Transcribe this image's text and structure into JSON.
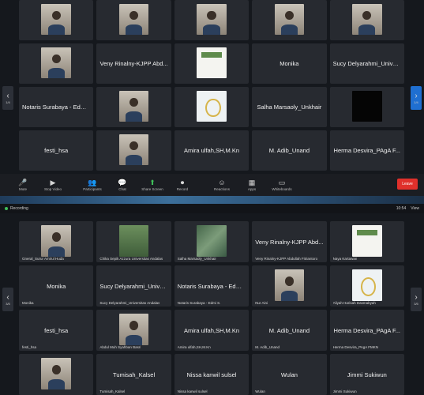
{
  "top": {
    "tiles": [
      {
        "name": "",
        "kind": "person"
      },
      {
        "name": "",
        "kind": "person"
      },
      {
        "name": "",
        "kind": "person"
      },
      {
        "name": "",
        "kind": "person"
      },
      {
        "name": "",
        "kind": "person"
      },
      {
        "name": "",
        "kind": "person"
      },
      {
        "name": "Veny Rinalny-KJPP Abd...",
        "kind": "name"
      },
      {
        "name": "",
        "kind": "slide"
      },
      {
        "name": "Monika",
        "kind": "name"
      },
      {
        "name": "Sucy Delyarahmi_Univer...",
        "kind": "name"
      },
      {
        "name": "Notaris Surabaya - Edmi...",
        "kind": "name"
      },
      {
        "name": "",
        "kind": "person"
      },
      {
        "name": "",
        "kind": "logo"
      },
      {
        "name": "Salha Marsaoly_Unkhair",
        "kind": "name"
      },
      {
        "name": "",
        "kind": "dark"
      },
      {
        "name": "festi_hsa",
        "kind": "name"
      },
      {
        "name": "",
        "kind": "person"
      },
      {
        "name": "Amira ulfah,SH,M.Kn",
        "kind": "name"
      },
      {
        "name": "M. Adib_Unand",
        "kind": "name"
      },
      {
        "name": "Herma Desvira_PAgA F...",
        "kind": "name"
      }
    ],
    "nav": {
      "left_page": "1/4",
      "right_page": "1/4"
    },
    "toolbar": [
      {
        "label": "Mute",
        "icon": "🎤"
      },
      {
        "label": "Stop Video",
        "icon": "▶"
      },
      {
        "label": "Participants",
        "icon": "👥"
      },
      {
        "label": "Chat",
        "icon": "💬"
      },
      {
        "label": "Share Screen",
        "icon": "⬆"
      },
      {
        "label": "Record",
        "icon": "⏺"
      },
      {
        "label": "Reactions",
        "icon": "☺"
      },
      {
        "label": "Apps",
        "icon": "▦"
      },
      {
        "label": "Whiteboards",
        "icon": "▭"
      }
    ],
    "leave_label": "Leave"
  },
  "bottom": {
    "recording_label": "Recording",
    "clock": "10:54",
    "view_label": "View",
    "tiles": [
      {
        "name": "",
        "kind": "person",
        "caption": "Gneral_Surur Amirul Huda"
      },
      {
        "name": "",
        "kind": "green",
        "caption": "Chika Sepik Azzura Universitas Andalas"
      },
      {
        "name": "",
        "kind": "map",
        "caption": "Salha Marsaoly_Unkhair"
      },
      {
        "name": "Veny Rinalny-KJPP Abd...",
        "kind": "name",
        "caption": "Veny Rinalny-KJPP Abdullah Fitriantoro"
      },
      {
        "name": "",
        "kind": "slide",
        "caption": "Naya Kartawan"
      },
      {
        "name": "Monika",
        "kind": "name",
        "caption": "Monika"
      },
      {
        "name": "Sucy Delyarahmi_Univer...",
        "kind": "name",
        "caption": "Sucy Delyarahmi_Universitas Andalas"
      },
      {
        "name": "Notaris Surabaya - Edmi...",
        "kind": "name",
        "caption": "Notaris Surabaya - Edmi S."
      },
      {
        "name": "",
        "kind": "person",
        "caption": "Nur Aini"
      },
      {
        "name": "",
        "kind": "logo",
        "caption": "Aliyah Harisah Dasmabyah"
      },
      {
        "name": "festi_hsa",
        "kind": "name",
        "caption": "festi_hsa"
      },
      {
        "name": "",
        "kind": "person",
        "caption": "Abdul Muh Syahban Basri"
      },
      {
        "name": "Amira ulfah,SH,M.Kn",
        "kind": "name",
        "caption": "Amira ulfah,SH,M.Kn"
      },
      {
        "name": "M. Adib_Unand",
        "kind": "name",
        "caption": "M. Adib_Unand"
      },
      {
        "name": "Herma Desvira_PAgA F...",
        "kind": "name",
        "caption": "Herma Desvira_PAgA FMKN"
      },
      {
        "name": "",
        "kind": "person",
        "caption": ""
      },
      {
        "name": "Tumisah_Kalsel",
        "kind": "name",
        "caption": "Tumisah_Kalsel"
      },
      {
        "name": "Nissa kanwil sulsel",
        "kind": "name",
        "caption": "Nissa kanwil sulsel"
      },
      {
        "name": "Wulan",
        "kind": "name",
        "caption": "Wulan"
      },
      {
        "name": "Jimmi Sukiwun",
        "kind": "name",
        "caption": "Jimmi Sukiwun"
      }
    ],
    "nav": {
      "left_page": "3/5",
      "right_page": "3/5"
    }
  }
}
